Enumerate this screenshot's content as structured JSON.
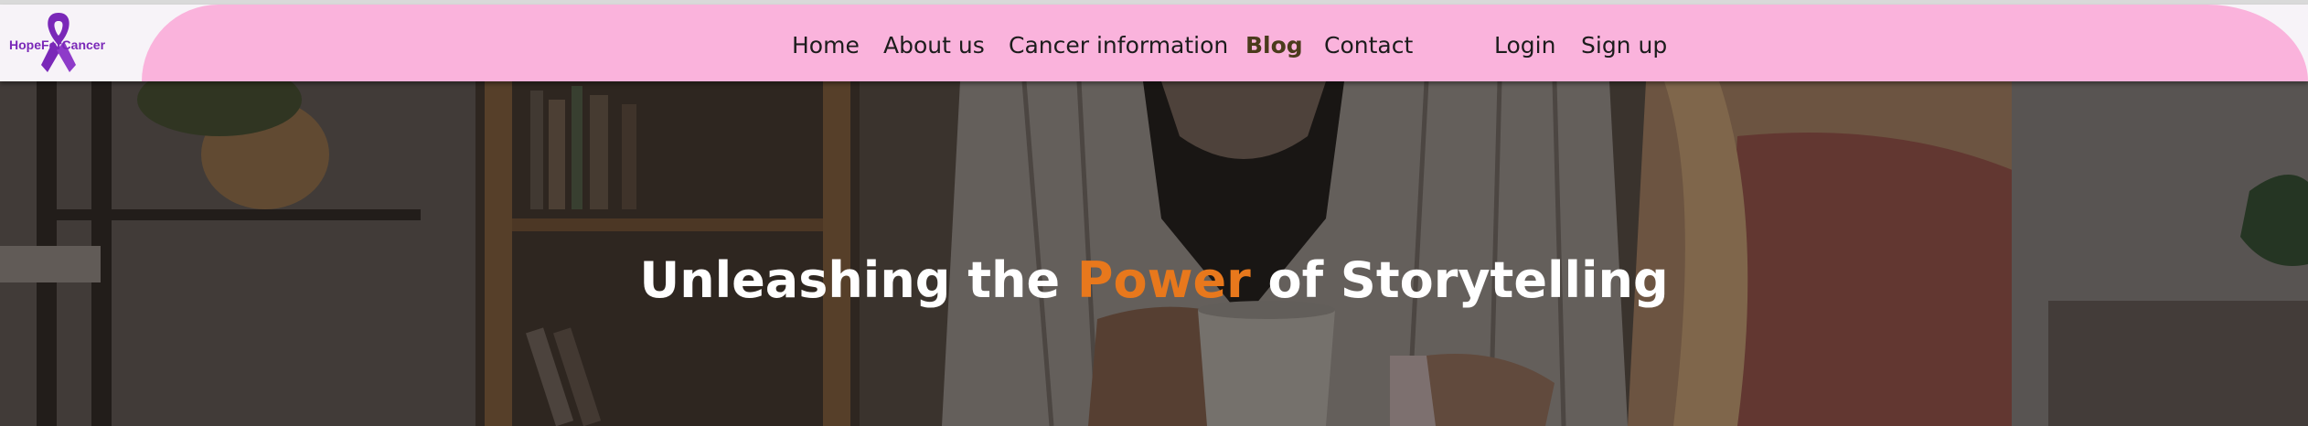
{
  "brand": {
    "name": "HopeForCancer",
    "ribbon_color": "#7a28b8"
  },
  "nav": {
    "items": [
      {
        "label": "Home"
      },
      {
        "label": "About us"
      },
      {
        "label": "Cancer information"
      },
      {
        "label": "Blog",
        "active": true
      },
      {
        "label": "Contact"
      }
    ],
    "auth": [
      {
        "label": "Login"
      },
      {
        "label": "Sign up"
      }
    ],
    "bar_color": "#fab3dc"
  },
  "hero": {
    "title_before": "Unleashing the ",
    "title_accent": "Power",
    "title_after": " of Storytelling",
    "accent_color": "#e8781c"
  }
}
